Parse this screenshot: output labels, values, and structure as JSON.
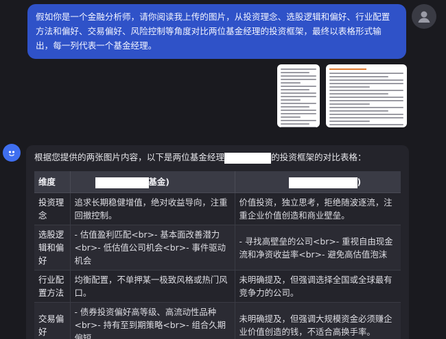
{
  "user_message": "假如你是一个金融分析师，请你阅读我上传的图片，从投资理念、选股逻辑和偏好、行业配置方法和偏好、交易偏好、风险控制等角度对比两位基金经理的投资框架，最终以表格形式输出，每一列代表一个基金经理。",
  "assistant": {
    "intro_prefix": "根据您提供的两张图片内容，以下是两位基金经理",
    "intro_suffix": "的投资框架的对比表格：",
    "table": {
      "headers": [
        "维度",
        "基金)",
        ")"
      ],
      "rows": [
        [
          "投资理念",
          "追求长期稳健增值，绝对收益导向，注重回撤控制。",
          "价值投资，独立思考，拒绝随波逐流，注重企业价值创造和商业壁垒。"
        ],
        [
          "选股逻辑和偏好",
          "- 估值盈利匹配<br>- 基本面改善潜力<br>- 低估值公司机会<br>- 事件驱动机会",
          "- 寻找高壁垒的公司<br>- 重视自由现金流和净资收益率<br>- 避免高估值泡沫"
        ],
        [
          "行业配置方法",
          "均衡配置，不单押某一极致风格或热门风口。",
          "未明确提及，但强调选择全国或全球最有竞争力的公司。"
        ],
        [
          "交易偏好",
          "- 债券投资偏好高等级、高流动性品种<br>- 持有至到期策略<br>- 组合久期偏短",
          "未明确提及，但强调大规模资金必须赚企业价值创造的钱，不适合高换手率。"
        ]
      ]
    }
  },
  "colors": {
    "background": "#1a1a1f",
    "user_bubble": "#2f52c8",
    "assistant_bubble": "#24242b",
    "accent": "#3f6ff0"
  },
  "icons": {
    "user_avatar": "user-silhouette-icon",
    "assistant_avatar": "bot-face-icon"
  }
}
